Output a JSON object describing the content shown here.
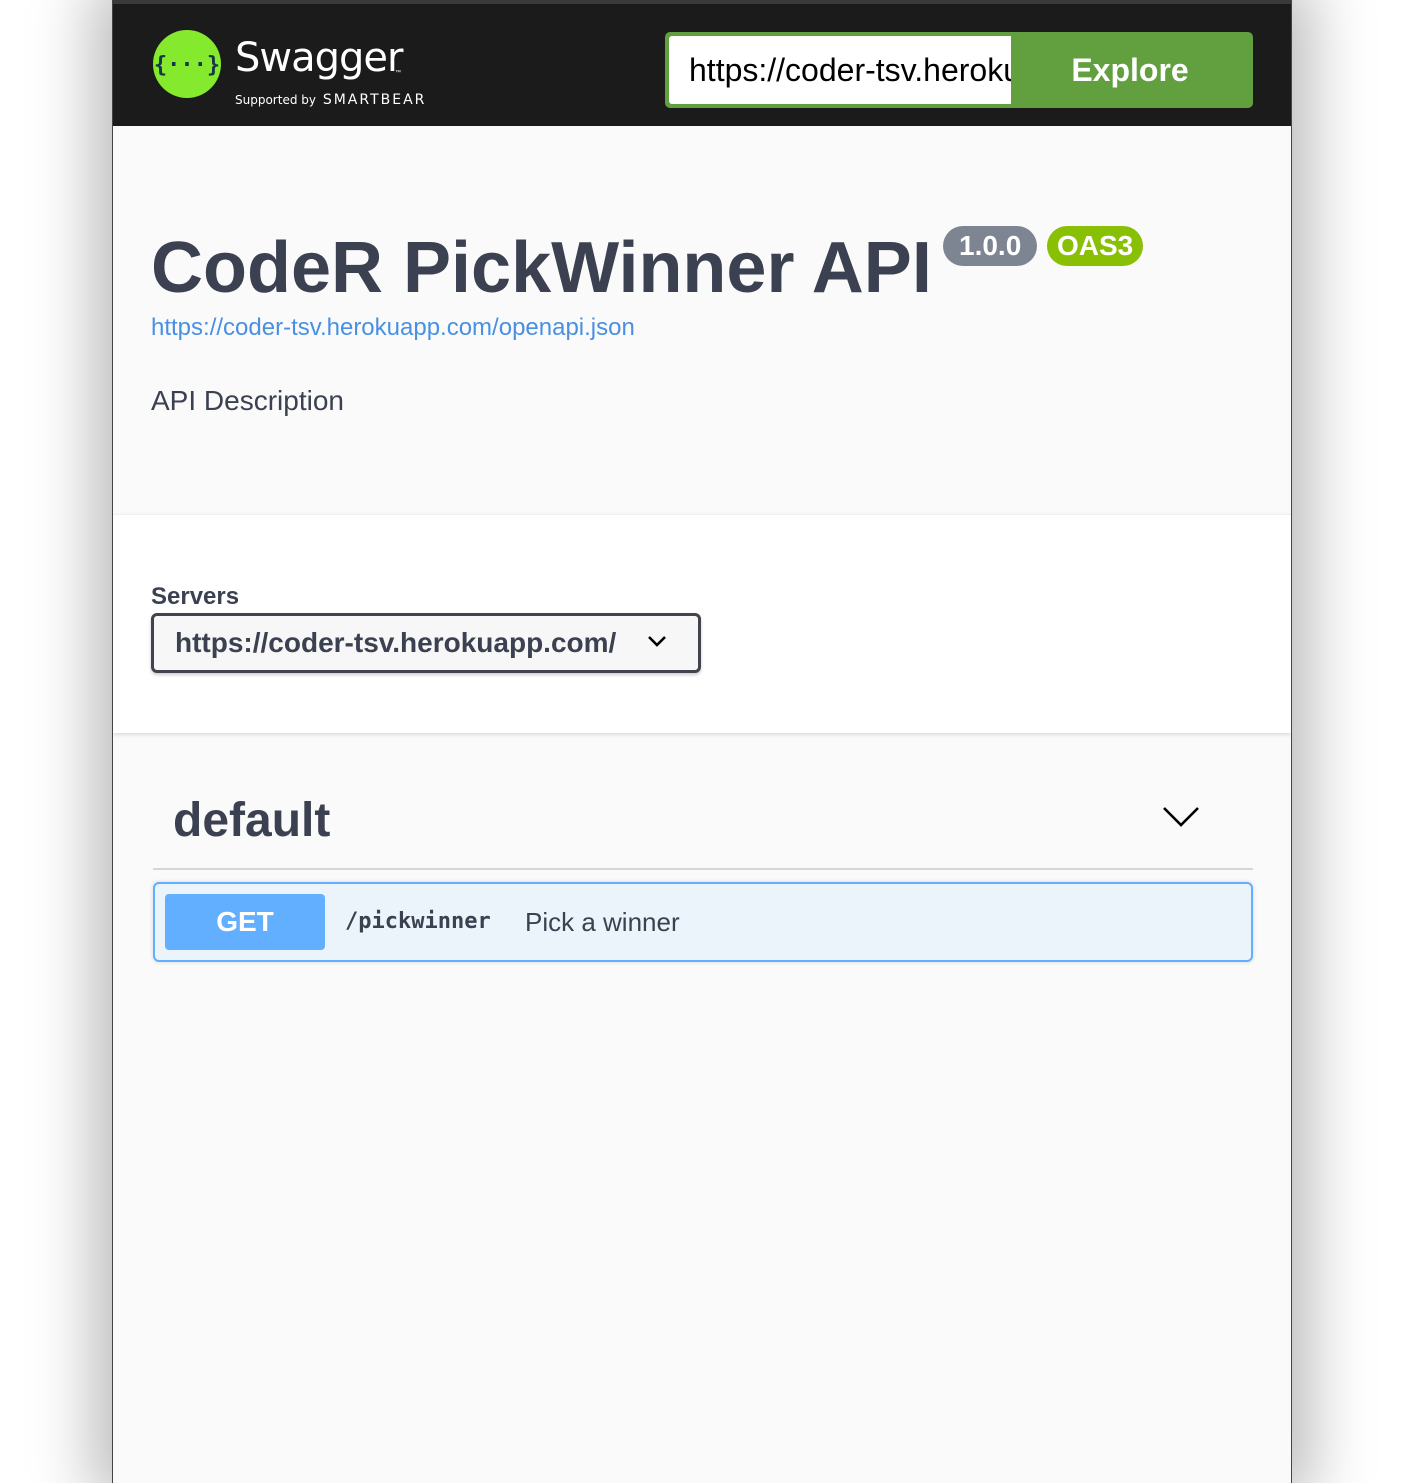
{
  "topbar": {
    "brand_name": "Swagger",
    "brand_tm": "™",
    "brand_supported": "Supported by",
    "brand_smartbear": "SMARTBEAR",
    "logo_glyph": "{···}",
    "url_value": "https://coder-tsv.herokuapp.com/openapi.json",
    "explore_label": "Explore"
  },
  "info": {
    "title": "CodeR PickWinner API",
    "version": "1.0.0",
    "oas": "OAS3",
    "spec_url": "https://coder-tsv.herokuapp.com/openapi.json",
    "description": "API Description"
  },
  "servers": {
    "label": "Servers",
    "selected": "https://coder-tsv.herokuapp.com/"
  },
  "operations": {
    "tag": "default",
    "items": [
      {
        "method": "GET",
        "path": "/pickwinner",
        "summary": "Pick a winner"
      }
    ]
  },
  "icons": {
    "logo": "swagger-logo-icon",
    "servers_dropdown": "chevron-down-icon",
    "tag_toggle": "chevron-down-icon"
  },
  "colors": {
    "topbar_bg": "#1b1b1b",
    "logo_green": "#85ea2d",
    "explore_green": "#62a03f",
    "title_text": "#3b4151",
    "link_blue": "#4990e2",
    "version_badge": "#7d8492",
    "oas_badge": "#89bf04",
    "get_blue": "#61affe",
    "get_bg": "#ebf3fb"
  }
}
